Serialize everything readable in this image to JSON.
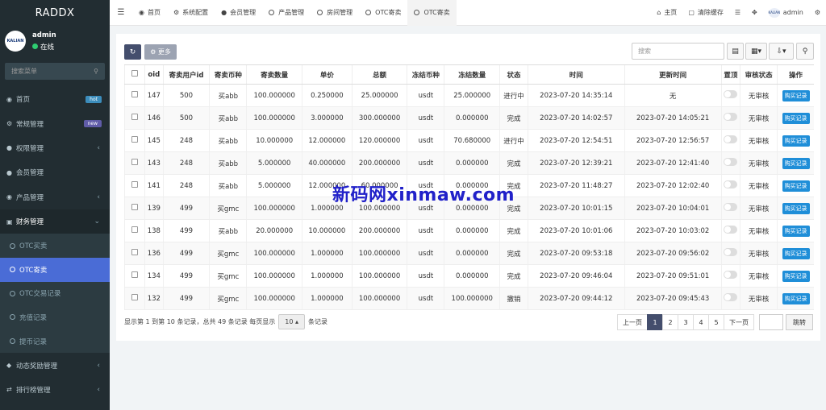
{
  "brand": "RADDX",
  "user": {
    "name": "admin",
    "status": "在线",
    "avatar_text": "KALIAN"
  },
  "sidebar_search_placeholder": "搜索菜单",
  "menu": [
    {
      "label": "首页",
      "icon": "dashboard-icon",
      "badge": "hot"
    },
    {
      "label": "常规管理",
      "icon": "gear-icon",
      "badge": "new"
    },
    {
      "label": "权限管理",
      "icon": "group-icon",
      "arrow": true
    },
    {
      "label": "会员管理",
      "icon": "user-icon"
    },
    {
      "label": "产品管理",
      "icon": "product-icon",
      "arrow": true
    },
    {
      "label": "财务管理",
      "icon": "finance-icon",
      "arrow": true,
      "open": true
    }
  ],
  "submenu": [
    {
      "label": "OTC买卖"
    },
    {
      "label": "OTC寄卖",
      "active": true
    },
    {
      "label": "OTC交易记录"
    },
    {
      "label": "充值记录"
    },
    {
      "label": "提币记录"
    }
  ],
  "menu_after": [
    {
      "label": "动态奖励管理",
      "icon": "reward-icon"
    },
    {
      "label": "排行榜管理",
      "icon": "rank-icon"
    }
  ],
  "topbar": {
    "tabs": [
      "首页",
      "系统配置",
      "会员管理",
      "产品管理",
      "房间管理",
      "OTC寄卖",
      "OTC寄卖"
    ],
    "home": "主页",
    "clear_cache": "清除缓存",
    "admin": "admin"
  },
  "toolbar": {
    "more": "更多",
    "search_placeholder": "搜索"
  },
  "table": {
    "headers": [
      "oid",
      "寄卖用户id",
      "寄卖币种",
      "寄卖数量",
      "单价",
      "总额",
      "冻结币种",
      "冻结数量",
      "状态",
      "时间",
      "更新时间",
      "置顶",
      "审核状态",
      "操作"
    ],
    "rows": [
      {
        "oid": "147",
        "uid": "500",
        "coin": "买abb",
        "coin_color": "gray",
        "qty": "100.000000",
        "price": "0.250000",
        "total": "25.000000",
        "fcoin": "usdt",
        "fqty": "25.000000",
        "status": "进行中",
        "status_color": "green",
        "time": "2023-07-20 14:35:14",
        "update": "无",
        "audit": "无审核",
        "action": "购买记录"
      },
      {
        "oid": "146",
        "uid": "500",
        "coin": "买abb",
        "coin_color": "gray",
        "qty": "100.000000",
        "price": "3.000000",
        "total": "300.000000",
        "fcoin": "usdt",
        "fqty": "0.000000",
        "status": "完成",
        "status_color": "red",
        "time": "2023-07-20 14:02:57",
        "update": "2023-07-20 14:05:21",
        "audit": "无审核",
        "action": "购买记录"
      },
      {
        "oid": "145",
        "uid": "248",
        "coin": "买abb",
        "coin_color": "gray",
        "qty": "10.000000",
        "price": "12.000000",
        "total": "120.000000",
        "fcoin": "usdt",
        "fqty": "70.680000",
        "status": "进行中",
        "status_color": "green",
        "time": "2023-07-20 12:54:51",
        "update": "2023-07-20 12:56:57",
        "audit": "无审核",
        "action": "购买记录"
      },
      {
        "oid": "143",
        "uid": "248",
        "coin": "买abb",
        "coin_color": "gray",
        "qty": "5.000000",
        "price": "40.000000",
        "total": "200.000000",
        "fcoin": "usdt",
        "fqty": "0.000000",
        "status": "完成",
        "status_color": "red",
        "time": "2023-07-20 12:39:21",
        "update": "2023-07-20 12:41:40",
        "audit": "无审核",
        "action": "购买记录"
      },
      {
        "oid": "141",
        "uid": "248",
        "coin": "买abb",
        "coin_color": "gray",
        "qty": "5.000000",
        "price": "12.000000",
        "total": "60.000000",
        "fcoin": "usdt",
        "fqty": "0.000000",
        "status": "完成",
        "status_color": "red",
        "time": "2023-07-20 11:48:27",
        "update": "2023-07-20 12:02:40",
        "audit": "无审核",
        "action": "购买记录"
      },
      {
        "oid": "139",
        "uid": "499",
        "coin": "买gmc",
        "coin_color": "green",
        "qty": "100.000000",
        "price": "1.000000",
        "total": "100.000000",
        "fcoin": "usdt",
        "fqty": "0.000000",
        "status": "完成",
        "status_color": "red",
        "time": "2023-07-20 10:01:15",
        "update": "2023-07-20 10:04:01",
        "audit": "无审核",
        "action": "购买记录"
      },
      {
        "oid": "138",
        "uid": "499",
        "coin": "买abb",
        "coin_color": "gray",
        "qty": "20.000000",
        "price": "10.000000",
        "total": "200.000000",
        "fcoin": "usdt",
        "fqty": "0.000000",
        "status": "完成",
        "status_color": "red",
        "time": "2023-07-20 10:01:06",
        "update": "2023-07-20 10:03:02",
        "audit": "无审核",
        "action": "购买记录"
      },
      {
        "oid": "136",
        "uid": "499",
        "coin": "买gmc",
        "coin_color": "green",
        "qty": "100.000000",
        "price": "1.000000",
        "total": "100.000000",
        "fcoin": "usdt",
        "fqty": "0.000000",
        "status": "完成",
        "status_color": "red",
        "time": "2023-07-20 09:53:18",
        "update": "2023-07-20 09:56:02",
        "audit": "无审核",
        "action": "购买记录"
      },
      {
        "oid": "134",
        "uid": "499",
        "coin": "买gmc",
        "coin_color": "green",
        "qty": "100.000000",
        "price": "1.000000",
        "total": "100.000000",
        "fcoin": "usdt",
        "fqty": "0.000000",
        "status": "完成",
        "status_color": "red",
        "time": "2023-07-20 09:46:04",
        "update": "2023-07-20 09:51:01",
        "audit": "无审核",
        "action": "购买记录"
      },
      {
        "oid": "132",
        "uid": "499",
        "coin": "买gmc",
        "coin_color": "green",
        "qty": "100.000000",
        "price": "1.000000",
        "total": "100.000000",
        "fcoin": "usdt",
        "fqty": "100.000000",
        "status": "撤销",
        "status_color": "gray",
        "time": "2023-07-20 09:44:12",
        "update": "2023-07-20 09:45:43",
        "audit": "无审核",
        "action": "购买记录"
      }
    ]
  },
  "footer": {
    "info_before": "显示第 1 到第 10 条记录，总共 49 条记录 每页显示",
    "page_size": "10",
    "info_after": "条记录"
  },
  "pager": {
    "prev": "上一页",
    "pages": [
      "1",
      "2",
      "3",
      "4",
      "5"
    ],
    "active": "1",
    "next": "下一页",
    "jump": "跳转"
  },
  "watermark": "新码网xinmaw.com",
  "colors": {
    "sidebar_bg": "#222d32",
    "active_sub": "#4a6cd6",
    "primary_btn": "#444e6d",
    "green": "#18bc9c",
    "red": "#e74c3c"
  }
}
